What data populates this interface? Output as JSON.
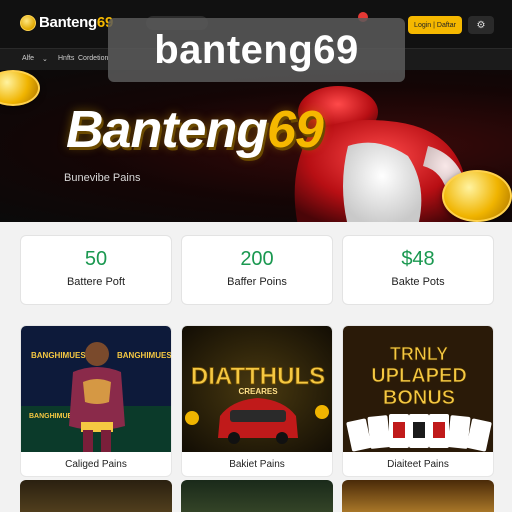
{
  "header": {
    "logo_text": "Banteng",
    "logo_number": "69",
    "login_label": "Login | Daftar",
    "settings_glyph": "⚙"
  },
  "watermark": {
    "text": "banteng69"
  },
  "subnav": {
    "items": [
      "Alfe",
      "Hnfts",
      "Cordetion"
    ]
  },
  "hero": {
    "title_text": "Banteng",
    "title_number": "69",
    "subtitle": "Bunevibe Pains"
  },
  "stats": [
    {
      "value": "50",
      "label": "Battere Poft"
    },
    {
      "value": "200",
      "label": "Baffer Poins"
    },
    {
      "value": "$48",
      "label": "Bakte Pots"
    }
  ],
  "games": [
    {
      "label": "Caliged Pains",
      "art_text": "BANGHIMUES"
    },
    {
      "label": "Bakiet Pains",
      "art_title": "DIATTHULS",
      "art_sub": "CREARES"
    },
    {
      "label": "Diaiteet Pains",
      "art_lines": [
        "TRNLY",
        "UPLAPED",
        "BONUS"
      ]
    }
  ],
  "colors": {
    "accent": "#f5b800",
    "stat_value": "#1a9850",
    "topbar": "#111111",
    "notification": "#e53935"
  }
}
